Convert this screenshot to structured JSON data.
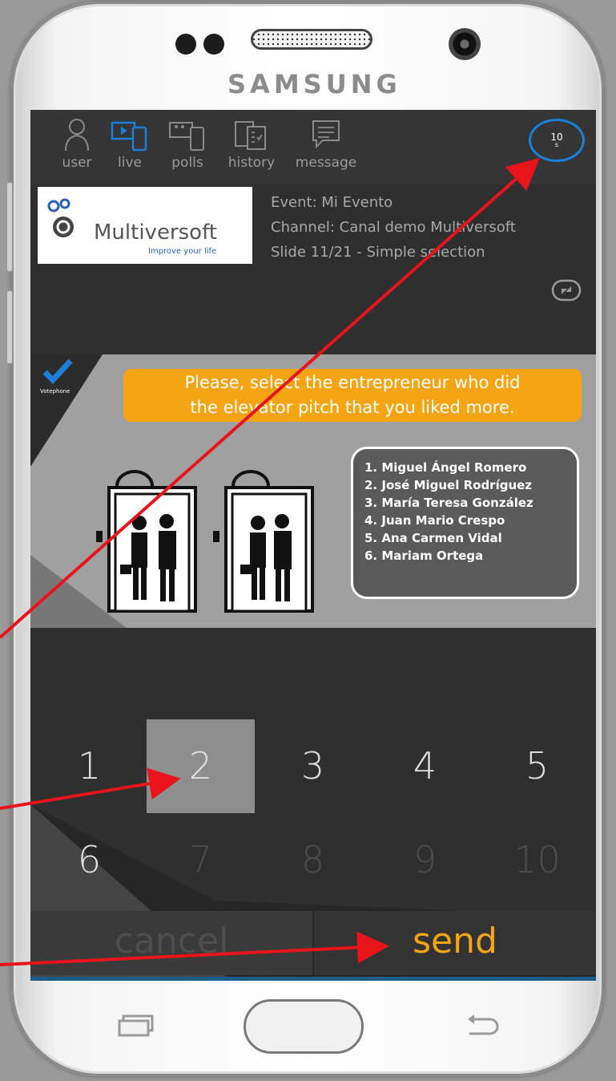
{
  "device": {
    "brand": "SAMSUNG"
  },
  "nav": {
    "items": [
      {
        "label": "user",
        "icon": "user-icon"
      },
      {
        "label": "live",
        "icon": "live-icon"
      },
      {
        "label": "polls",
        "icon": "polls-icon"
      },
      {
        "label": "history",
        "icon": "history-icon"
      },
      {
        "label": "message",
        "icon": "message-icon"
      }
    ],
    "active": "live",
    "timer": {
      "value": "10",
      "unit": "s"
    }
  },
  "header": {
    "logo_text": "Multiversoft",
    "logo_tagline": "Improve your life",
    "event": "Event: Mi Evento",
    "channel": "Channel: Canal demo Multiversoft",
    "slide": "Slide 11/21 - Simple selection"
  },
  "slide": {
    "brand_small": "Votephone",
    "question_line1": "Please, select the entrepreneur who did",
    "question_line2": "the elevator pitch that you liked more.",
    "candidates": [
      "1. Miguel Ángel Romero",
      "2. José Miguel  Rodríguez",
      "3. María Teresa González",
      "4. Juan Mario Crespo",
      "5. Ana Carmen Vidal",
      "6. Mariam Ortega"
    ]
  },
  "options": {
    "numbers": [
      "1",
      "2",
      "3",
      "4",
      "5",
      "6",
      "7",
      "8",
      "9",
      "10"
    ],
    "selected": "2",
    "disabled": [
      "7",
      "8",
      "9",
      "10"
    ]
  },
  "actions": {
    "cancel_label": "cancel",
    "send_label": "send"
  },
  "colors": {
    "accent": "#f5a514",
    "active_blue": "#1e7fd8",
    "arrow": "#e8141c"
  }
}
